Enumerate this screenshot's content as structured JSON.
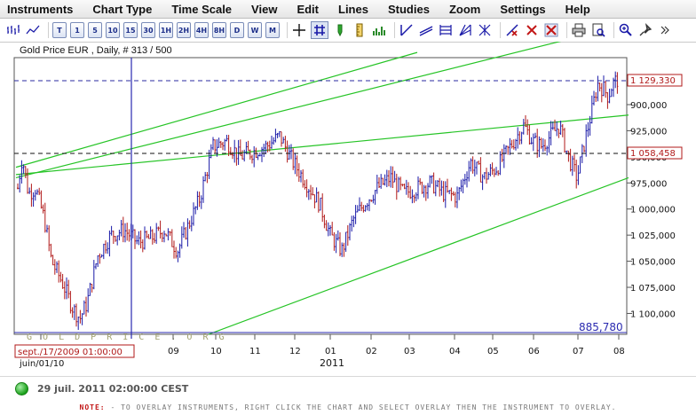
{
  "menu": [
    "Instruments",
    "Chart Type",
    "Time Scale",
    "View",
    "Edit",
    "Lines",
    "Studies",
    "Zoom",
    "Settings",
    "Help"
  ],
  "toolbar": {
    "periods": [
      "T",
      "1",
      "5",
      "10",
      "15",
      "30",
      "1H",
      "2H",
      "4H",
      "8H",
      "D",
      "W",
      "M"
    ]
  },
  "chart": {
    "title": "Gold Price EUR , Daily, # 313 / 500",
    "watermark": "G O L D P R I C E . O R G",
    "cursor_date_label": "sept./17/2009 01:00:00",
    "cursor_price_label": "885,780",
    "ref_line_1_label": "1 129,330",
    "ref_line_2_label": "1 058,458",
    "x_ticks": [
      {
        "label": "juin/01/10"
      },
      {
        "label": "09"
      },
      {
        "label": "10"
      },
      {
        "label": "11"
      },
      {
        "label": "12"
      },
      {
        "label": "01"
      },
      {
        "label": "02"
      },
      {
        "label": "03"
      },
      {
        "label": "04"
      },
      {
        "label": "05"
      },
      {
        "label": "06"
      },
      {
        "label": "07"
      },
      {
        "label": "08"
      }
    ],
    "year_label": "2011",
    "y_ticks": [
      "1 100,000",
      "1 075,000",
      "1 050,000",
      "1 025,000",
      "1 000,000",
      "975,000",
      "950,000",
      "925,000",
      "900,000"
    ]
  },
  "chart_data": {
    "type": "ohlc",
    "title": "Gold Price EUR , Daily, # 313 / 500",
    "ylim": [
      880,
      1145
    ],
    "y_ticks": [
      900,
      925,
      950,
      975,
      1000,
      1025,
      1050,
      1075,
      1100
    ],
    "x_tick_labels": [
      "juin/01/10",
      "09",
      "10",
      "11",
      "12",
      "01",
      "02",
      "03",
      "04",
      "05",
      "06",
      "07",
      "08"
    ],
    "reference_lines": [
      1129.33,
      1058.458
    ],
    "cursor": {
      "date": "sept./17/2009 01:00:00",
      "price": 885.78
    },
    "price_keypoints": [
      [
        0,
        960
      ],
      [
        8,
        940
      ],
      [
        14,
        990
      ],
      [
        20,
        1020
      ],
      [
        25,
        1050
      ],
      [
        32,
        1015
      ],
      [
        40,
        1020
      ],
      [
        50,
        990
      ],
      [
        58,
        950
      ],
      [
        70,
        930
      ],
      [
        82,
        905
      ],
      [
        90,
        895
      ],
      [
        98,
        910
      ],
      [
        110,
        955
      ],
      [
        125,
        975
      ],
      [
        140,
        980
      ],
      [
        155,
        968
      ],
      [
        170,
        972
      ],
      [
        185,
        980
      ],
      [
        200,
        960
      ],
      [
        215,
        990
      ],
      [
        225,
        1010
      ],
      [
        240,
        1060
      ],
      [
        255,
        1065
      ],
      [
        270,
        1050
      ],
      [
        285,
        1055
      ],
      [
        300,
        1060
      ],
      [
        315,
        1070
      ],
      [
        330,
        1045
      ],
      [
        345,
        1025
      ],
      [
        360,
        1005
      ],
      [
        372,
        975
      ],
      [
        385,
        960
      ],
      [
        398,
        990
      ],
      [
        410,
        1005
      ],
      [
        425,
        1020
      ],
      [
        440,
        1030
      ],
      [
        455,
        1015
      ],
      [
        470,
        1020
      ],
      [
        485,
        1025
      ],
      [
        500,
        1015
      ],
      [
        515,
        1012
      ],
      [
        530,
        1045
      ],
      [
        545,
        1030
      ],
      [
        560,
        1040
      ],
      [
        575,
        1060
      ],
      [
        590,
        1080
      ],
      [
        600,
        1065
      ],
      [
        610,
        1060
      ],
      [
        620,
        1070
      ],
      [
        630,
        1080
      ],
      [
        640,
        1050
      ],
      [
        650,
        1030
      ],
      [
        655,
        1050
      ],
      [
        660,
        1070
      ],
      [
        667,
        1095
      ],
      [
        673,
        1120
      ],
      [
        680,
        1115
      ],
      [
        685,
        1108
      ],
      [
        690,
        1120
      ],
      [
        697,
        1125
      ]
    ],
    "trend_lines": [
      {
        "from": [
          18,
          1033
        ],
        "to": [
          708,
          1090
        ]
      },
      {
        "from": [
          18,
          1030
        ],
        "to": [
          708,
          1177
        ]
      },
      {
        "from": [
          18,
          1040
        ],
        "to": [
          470,
          1150
        ]
      },
      {
        "from": [
          235,
          880
        ],
        "to": [
          708,
          1030
        ]
      }
    ]
  },
  "status": {
    "timestamp": "29 juil. 2011 02:00:00 CEST"
  },
  "note": {
    "label": "NOTE:",
    "text": " - TO OVERLAY INSTRUMENTS, RIGHT CLICK THE CHART AND SELECT OVERLAY THEN THE INSTRUMENT TO OVERLAY."
  },
  "colors": {
    "price_bar": "#1a1aa8",
    "price_bar_down": "#b01818",
    "trend_line": "#26c426",
    "ref_line": "#2a2aa0",
    "ref_label": "#b01818",
    "cursor_line": "#2a2ab0"
  }
}
